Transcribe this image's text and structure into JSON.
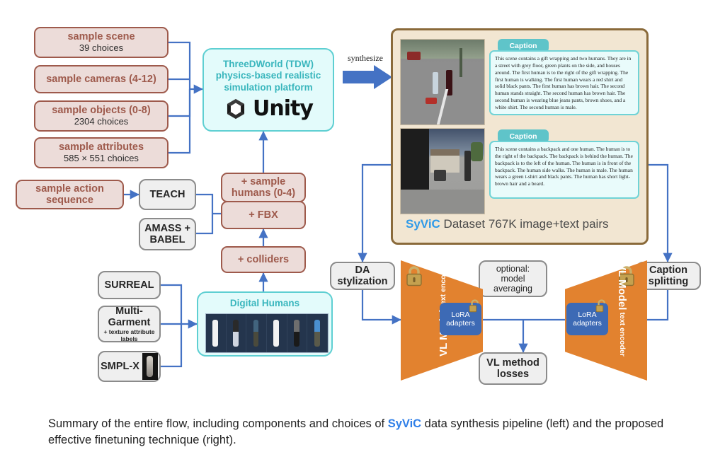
{
  "colors": {
    "pink_fill": "#ecdcd9",
    "pink_border": "#9e5a4c",
    "grey_fill": "#efefef",
    "grey_border": "#8b8b8b",
    "cyan_fill": "#e3fbfb",
    "cyan_border": "#5ecfd2",
    "arrow_blue": "#4472c4",
    "orange": "#e2822f",
    "lora_blue": "#3d6ab5",
    "panel_bg": "#f2e6d2",
    "panel_border": "#8a6a3a",
    "accent_link": "#2f9ae8"
  },
  "sampling": {
    "scene": {
      "title": "sample scene",
      "sub": "39 choices"
    },
    "cameras": {
      "title": "sample cameras (4-12)",
      "sub": ""
    },
    "objects": {
      "title": "sample objects (0-8)",
      "sub": "2304 choices"
    },
    "attributes": {
      "title": "sample attributes",
      "sub": "585 × 551 choices"
    }
  },
  "engine": {
    "line1": "ThreeDWorld (TDW)",
    "line2": "physics-based realistic",
    "line3": "simulation platform",
    "logo_text": "Unity",
    "logo_icon": "unity-cube-icon"
  },
  "synthesize_arrow": {
    "label": "synthesize",
    "icon": "block-arrow-right-icon"
  },
  "humans_chain": {
    "sample_humans": "+ sample\nhumans (0-4)",
    "sample_humans_l1": "+ sample",
    "sample_humans_l2": "humans (0-4)",
    "fbx": "+ FBX",
    "colliders": "+ colliders"
  },
  "motion": {
    "action_seq_l1": "sample action",
    "action_seq_l2": "sequence",
    "teach": "TEACH",
    "amass_l1": "AMASS +",
    "amass_l2": "BABEL"
  },
  "assets": {
    "surreal": "SURREAL",
    "multigarment_l1": "Multi-",
    "multigarment_l2": "Garment",
    "multigarment_sub": "+ texture attribute labels",
    "smplx": "SMPL-X",
    "smplx_icon": "body-mesh-thumbnail"
  },
  "digital_humans": {
    "title": "Digital Humans",
    "thumbnails": [
      "human-1",
      "human-2",
      "human-3",
      "human-4",
      "human-5",
      "human-6"
    ]
  },
  "dataset_panel": {
    "caption_tab": "Caption",
    "scene1_image": "street-scene-two-humans-thumbnail",
    "scene2_image": "driveway-scene-backpack-human-thumbnail",
    "caption1": "This scene contains a gift wrapping and two humans. They are in a street with grey floor, green plants on the side, and houses around. The first human is to the right of the gift wrapping. The first human is walking. The first human wears a red shirt and solid black pants. The first human has brown hair. The second human stands straight. The second human has brown hair. The second human is wearing blue jeans pants, brown shoes, and a white shirt. The second human is male.",
    "caption2": "This scene contains a backpack and one human. The human is to the right of the backpack. The backpack is behind the human. The backpack is to the left of the human. The human is in front of the backpack. The human side walks. The human is male. The human wears a green t-shirt and black pants. The human has short light-brown hair and a beard.",
    "footer_brand": "SyViC",
    "footer_rest": " Dataset 767K image+text pairs"
  },
  "finetune": {
    "da_stylization_l1": "DA",
    "da_stylization_l2": "stylization",
    "caption_splitting_l1": "Caption",
    "caption_splitting_l2": "splitting",
    "optional_l1": "optional:",
    "optional_l2": "model",
    "optional_l3": "averaging",
    "losses_l1": "VL method",
    "losses_l2": "losses",
    "vl_model": "VL Model",
    "text_encoder": "text encoder",
    "lora_l1": "LoRA",
    "lora_l2": "adapters",
    "lock_icon": "closed-padlock-icon",
    "unlock_icon": "open-padlock-icon"
  },
  "figure_caption": {
    "pre": "Summary of the entire flow, including components and choices of ",
    "brand": "SyViC",
    "post": " data synthesis pipeline (left) and the proposed effective finetuning technique (right)."
  }
}
